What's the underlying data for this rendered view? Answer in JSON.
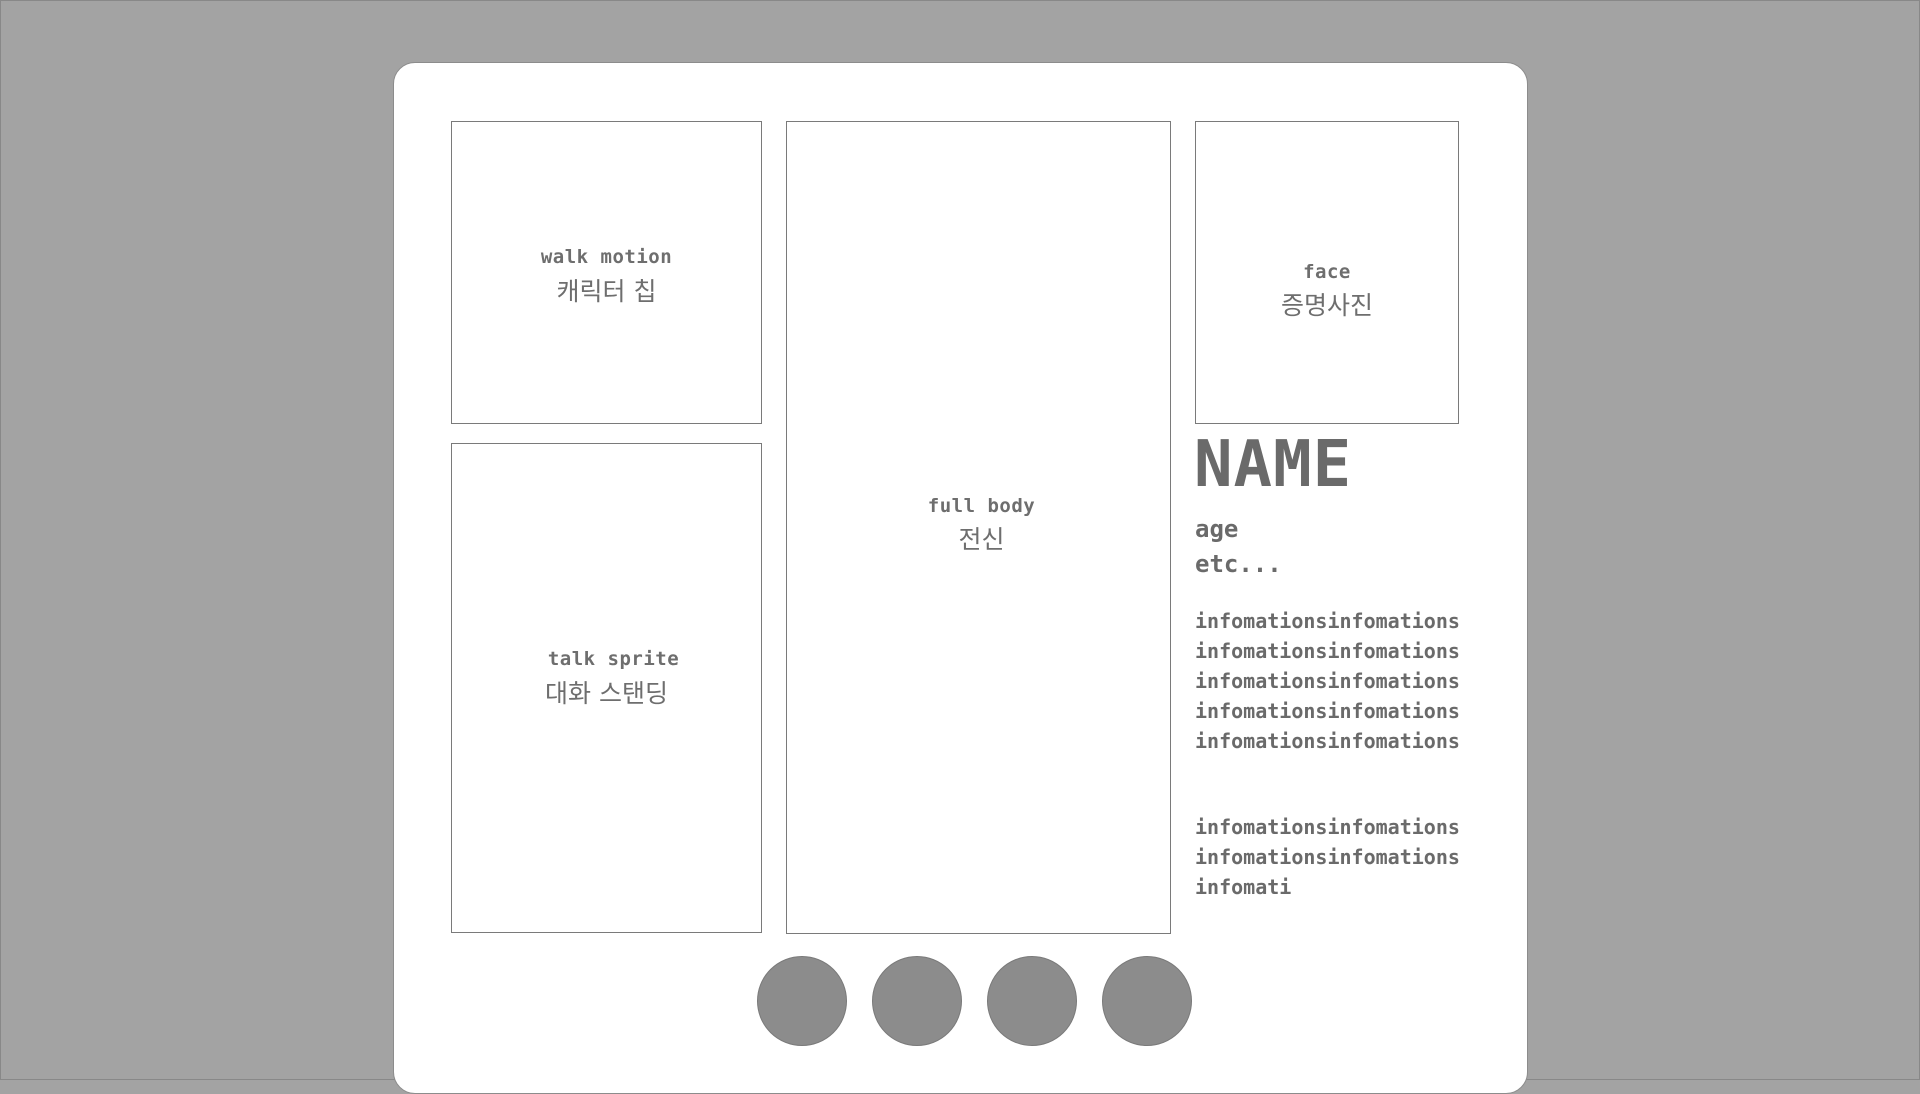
{
  "panels": {
    "walk": {
      "label": "walk motion",
      "sub": "캐릭터 칩"
    },
    "talk": {
      "label": "talk sprite",
      "sub": "대화 스탠딩"
    },
    "full": {
      "label": "full body",
      "sub": "전신"
    },
    "face": {
      "label": "face",
      "sub": "증명사진"
    }
  },
  "profile": {
    "name": "NAME",
    "age": "age",
    "etc": "etc...",
    "info1": "infomationsinfomationsinfomationsinfomationsinfomationsinfomationsinfomationsinfomationsinfomationsinfomations",
    "info2": "infomationsinfomationsinfomationsinfomationsinfomati"
  },
  "page_buttons": {
    "count": 4,
    "color": "#8c8c8c"
  },
  "colors": {
    "background": "#a3a3a3",
    "card": "#ffffff",
    "text": "#6a6a6a"
  }
}
